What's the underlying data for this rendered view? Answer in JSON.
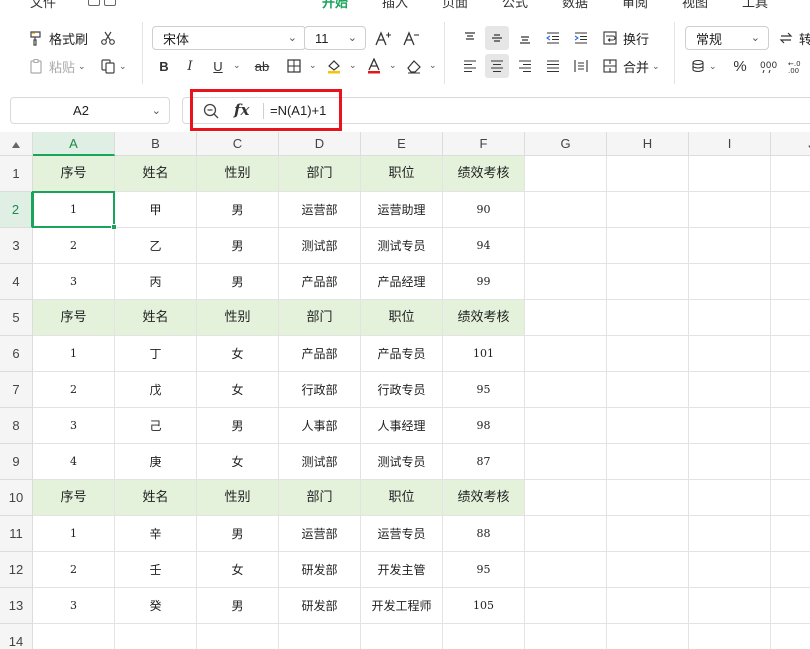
{
  "menu": {
    "tabs": [
      {
        "label": "文件",
        "active": false
      },
      {
        "label": "开始",
        "active": true
      },
      {
        "label": "插入",
        "active": false
      },
      {
        "label": "页面",
        "active": false
      },
      {
        "label": "公式",
        "active": false
      },
      {
        "label": "数据",
        "active": false
      },
      {
        "label": "审阅",
        "active": false
      },
      {
        "label": "视图",
        "active": false
      },
      {
        "label": "工具",
        "active": false
      }
    ]
  },
  "ribbon": {
    "format_painter_label": "格式刷",
    "paste_label": "粘贴",
    "font_name": "宋体",
    "font_size": "11",
    "bold": "B",
    "italic": "I",
    "underline": "U",
    "strikethrough": "ab",
    "wrap_label": "换行",
    "merge_label": "合并",
    "number_format": "常规",
    "percent": "%",
    "convert_label": "转"
  },
  "formula_bar": {
    "cell_ref": "A2",
    "fx": "fx",
    "formula": "=N(A1)+1"
  },
  "sheet": {
    "columns": [
      "A",
      "B",
      "C",
      "D",
      "E",
      "F",
      "G",
      "H",
      "I",
      "J"
    ],
    "selected_column": "A",
    "selected_row": 2,
    "rows": [
      {
        "num": "1",
        "cells": [
          "序号",
          "姓名",
          "性别",
          "部门",
          "职位",
          "绩效考核"
        ],
        "header": true
      },
      {
        "num": "2",
        "cells": [
          "1",
          "甲",
          "男",
          "运营部",
          "运营助理",
          "90"
        ],
        "header": false
      },
      {
        "num": "3",
        "cells": [
          "2",
          "乙",
          "男",
          "测试部",
          "测试专员",
          "94"
        ],
        "header": false
      },
      {
        "num": "4",
        "cells": [
          "3",
          "丙",
          "男",
          "产品部",
          "产品经理",
          "99"
        ],
        "header": false
      },
      {
        "num": "5",
        "cells": [
          "序号",
          "姓名",
          "性别",
          "部门",
          "职位",
          "绩效考核"
        ],
        "header": true
      },
      {
        "num": "6",
        "cells": [
          "1",
          "丁",
          "女",
          "产品部",
          "产品专员",
          "101"
        ],
        "header": false
      },
      {
        "num": "7",
        "cells": [
          "2",
          "戊",
          "女",
          "行政部",
          "行政专员",
          "95"
        ],
        "header": false
      },
      {
        "num": "8",
        "cells": [
          "3",
          "己",
          "男",
          "人事部",
          "人事经理",
          "98"
        ],
        "header": false
      },
      {
        "num": "9",
        "cells": [
          "4",
          "庚",
          "女",
          "测试部",
          "测试专员",
          "87"
        ],
        "header": false
      },
      {
        "num": "10",
        "cells": [
          "序号",
          "姓名",
          "性别",
          "部门",
          "职位",
          "绩效考核"
        ],
        "header": true
      },
      {
        "num": "11",
        "cells": [
          "1",
          "辛",
          "男",
          "运营部",
          "运营专员",
          "88"
        ],
        "header": false
      },
      {
        "num": "12",
        "cells": [
          "2",
          "壬",
          "女",
          "研发部",
          "开发主管",
          "95"
        ],
        "header": false
      },
      {
        "num": "13",
        "cells": [
          "3",
          "癸",
          "男",
          "研发部",
          "开发工程师",
          "105"
        ],
        "header": false
      },
      {
        "num": "14",
        "cells": [
          "",
          "",
          "",
          "",
          "",
          ""
        ],
        "header": false
      }
    ]
  },
  "colors": {
    "accent": "#1aa35a",
    "header_fill": "#e4f2dc",
    "highlight_border": "#e8141c"
  }
}
